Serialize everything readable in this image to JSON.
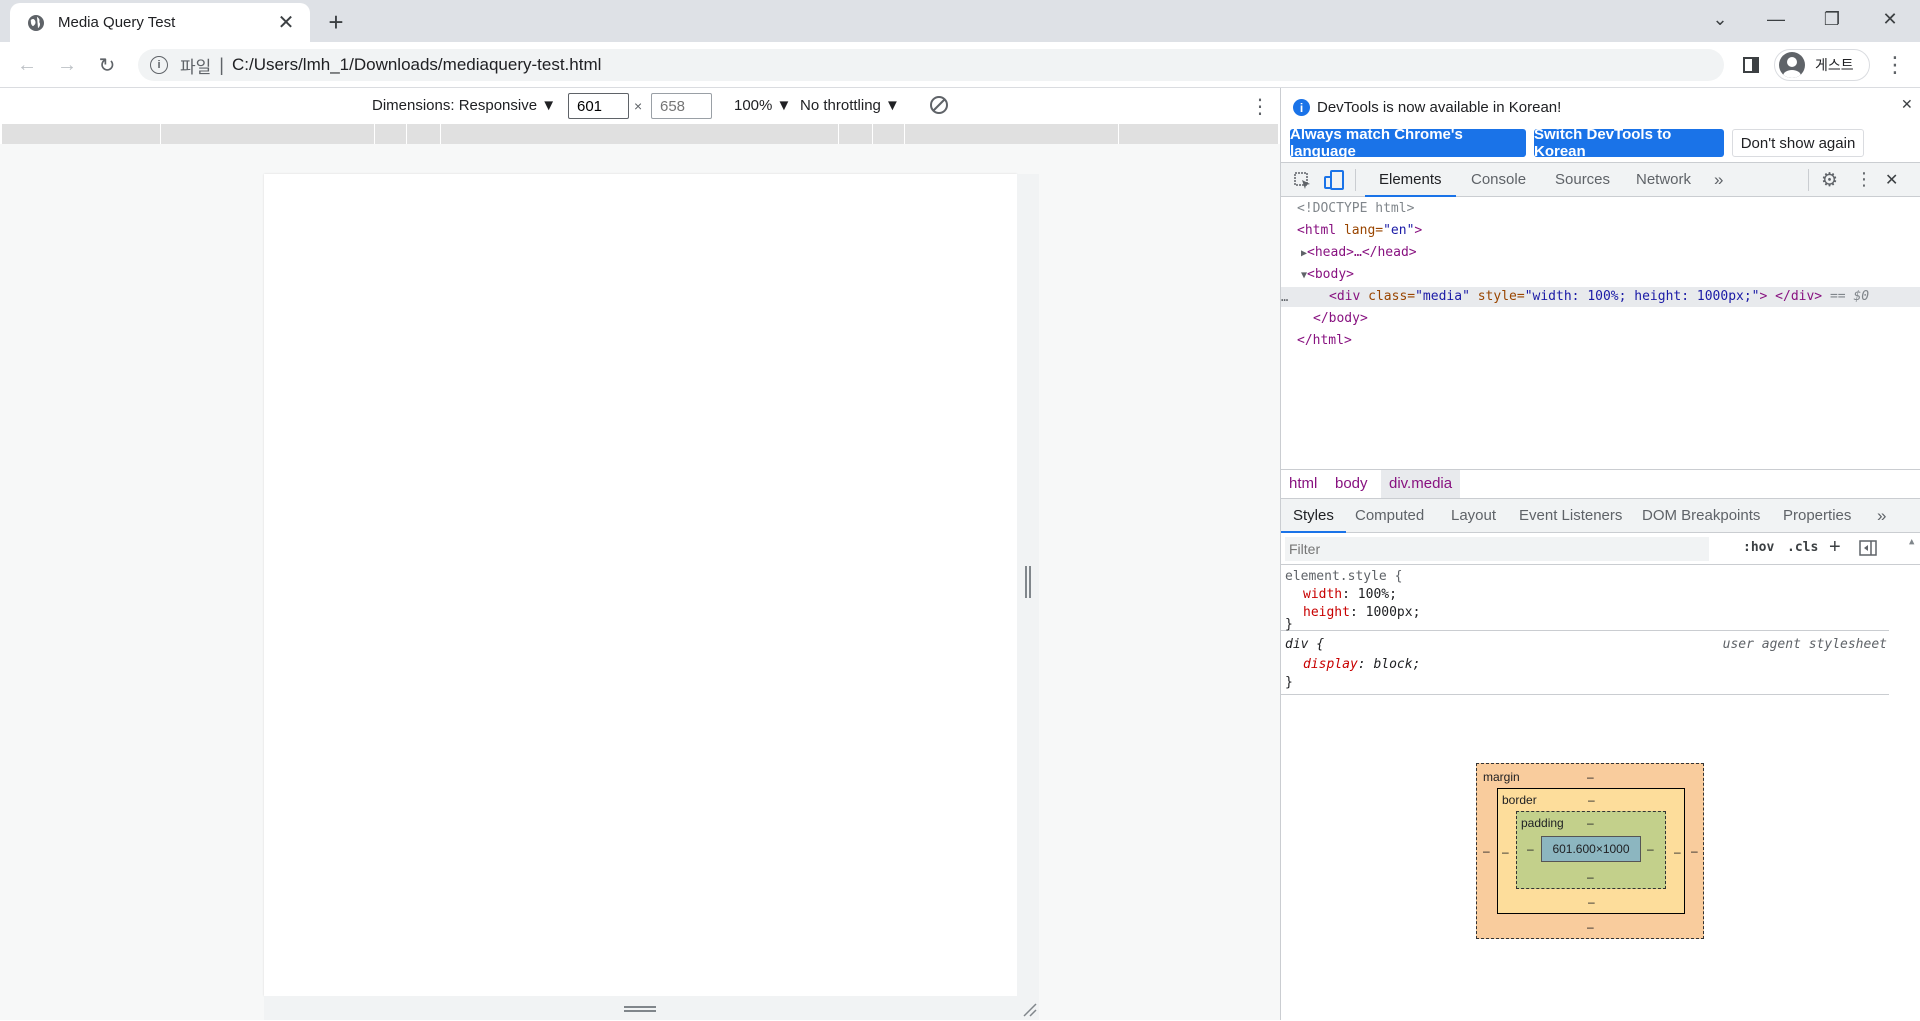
{
  "browser": {
    "tab_title": "Media Query Test",
    "new_tab_symbol": "+",
    "scheme_label": "파일",
    "separator": "|",
    "url": "C:/Users/lmh_1/Downloads/mediaquery-test.html",
    "profile_label": "게스트"
  },
  "device_toolbar": {
    "dimensions_label": "Dimensions: Responsive ▼",
    "width_value": "601",
    "height_placeholder": "658",
    "times": "×",
    "zoom_label": "100% ▼",
    "throttling_label": "No throttling ▼"
  },
  "devtools": {
    "notice": "DevTools is now available in Korean!",
    "btn_match": "Always match Chrome's language",
    "btn_switch": "Switch DevTools to Korean",
    "btn_dismiss": "Don't show again",
    "tabs": [
      "Elements",
      "Console",
      "Sources",
      "Network"
    ],
    "more_tabs": "»",
    "dom": {
      "doctype": "<!DOCTYPE html>",
      "html_open_tag": "<html",
      "html_lang_attr": " lang=",
      "html_lang_val": "\"en\"",
      "html_open_end": ">",
      "head": "<head>…</head>",
      "body_open": "<body>",
      "div_open": "<div",
      "div_class_attr": " class=",
      "div_class_val": "\"media\"",
      "div_style_attr": " style=",
      "div_style_val": "\"width: 100%; height: 1000px;\"",
      "div_close": "> </div>",
      "selected_marker": "== $0",
      "ellipsis": "…",
      "body_close": "</body>",
      "html_close": "</html>"
    },
    "breadcrumbs": [
      "html",
      "body",
      "div.media"
    ],
    "styles_tabs": [
      "Styles",
      "Computed",
      "Layout",
      "Event Listeners",
      "DOM Breakpoints",
      "Properties"
    ],
    "filter_placeholder": "Filter",
    "hov": ":hov",
    "cls": ".cls",
    "plus": "+",
    "rule1": {
      "selector": "element.style {",
      "props": [
        {
          "name": "width",
          "value": "100%;"
        },
        {
          "name": "height",
          "value": "1000px;"
        }
      ],
      "close": "}"
    },
    "rule2": {
      "selector": "div {",
      "source": "user agent stylesheet",
      "props": [
        {
          "name": "display",
          "value": "block;"
        }
      ],
      "close": "}"
    },
    "box_model": {
      "margin_label": "margin",
      "border_label": "border",
      "padding_label": "padding",
      "content": "601.600×1000",
      "dash": "–"
    }
  }
}
